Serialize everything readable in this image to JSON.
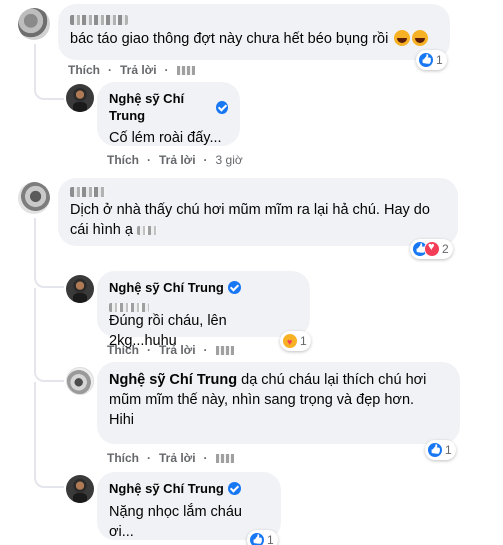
{
  "comments": [
    {
      "id": "c1",
      "author": "",
      "text": "bác táo giao thông đợt này chưa hết béo bụng rồi",
      "actions": {
        "like": "Thích",
        "reply": "Trả lời",
        "time": ""
      },
      "reaction_count": "1",
      "replies": [
        {
          "author": "Nghệ sỹ Chí Trung",
          "text": "Cố lém roài đấy...",
          "actions": {
            "like": "Thích",
            "reply": "Trả lời",
            "time": "3 giờ"
          }
        }
      ]
    },
    {
      "id": "c2",
      "author": "",
      "text_line1": "Dịch ở nhà thấy chú hơi mũm mĩm ra lại hả chú. Hay do",
      "text_line2": "cái hình ạ",
      "actions": {
        "like": "Thích",
        "reply": "Trả lời",
        "time": ""
      },
      "reaction_count": "2",
      "replies": [
        {
          "author": "Nghệ sỹ Chí Trung",
          "text": "Đúng rồi cháu, lên 2kg...huhu",
          "actions": {
            "like": "Thích",
            "reply": "Trả lời",
            "time": ""
          },
          "reaction_count": "1"
        },
        {
          "author": "Nghệ sỹ Chí Trung",
          "text_line1": "dạ chú cháu lại thích chú hơi",
          "text_line2": "mũm mĩm thế này, nhìn sang trọng và đẹp hơn.",
          "text_line3": "Hihi",
          "actions": {
            "like": "Thích",
            "reply": "Trả lời",
            "time": ""
          },
          "reaction_count": "1"
        },
        {
          "author": "Nghệ sỹ Chí Trung",
          "text": "Nặng nhọc lắm cháu ơi...",
          "reaction_count": "1"
        }
      ]
    }
  ],
  "colors": {
    "bubble": "#f0f2f5",
    "meta": "#65676b",
    "verified": "#1877f2"
  }
}
